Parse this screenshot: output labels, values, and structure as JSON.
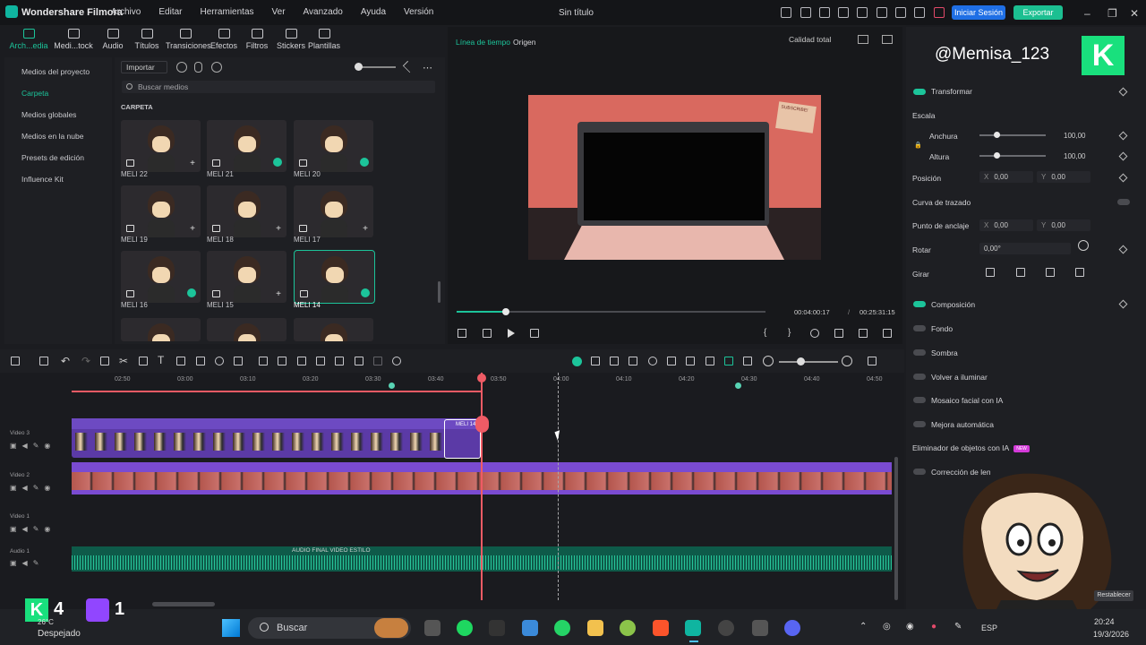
{
  "app": {
    "name": "Wondershare Filmora",
    "title": "Sin título"
  },
  "menu": [
    "Archivo",
    "Editar",
    "Herramientas",
    "Ver",
    "Avanzado",
    "Ayuda",
    "Versión"
  ],
  "header": {
    "login": "Iniciar Sesión",
    "export": "Exportar"
  },
  "tools": [
    {
      "label": "Arch...edia"
    },
    {
      "label": "Medi...tock"
    },
    {
      "label": "Audio"
    },
    {
      "label": "Títulos"
    },
    {
      "label": "Transiciones"
    },
    {
      "label": "Efectos"
    },
    {
      "label": "Filtros"
    },
    {
      "label": "Stickers"
    },
    {
      "label": "Plantillas"
    }
  ],
  "leftnav": [
    "Medios del proyecto",
    "Carpeta",
    "Medios globales",
    "Medios en la nube",
    "Presets de edición",
    "Influence Kit"
  ],
  "media": {
    "import": "Importar",
    "search_placeholder": "Buscar medios",
    "folder": "CARPETA",
    "items": [
      "MELI 22",
      "MELI 21",
      "MELI 20",
      "MELI 19",
      "MELI 18",
      "MELI 17",
      "MELI 16",
      "MELI 15",
      "MELI 14"
    ]
  },
  "preview": {
    "tab_timeline": "Línea de tiempo",
    "tab_source": "Origen",
    "quality": "Calidad total",
    "current_time": "00:04:00:17",
    "separator": "/",
    "total_time": "00:25:31:15",
    "progress": 0.16,
    "note": "SUBSCRIBE!"
  },
  "overlay": {
    "handle": "@Memisa_123",
    "logo_letter": "K",
    "kick_count": "4",
    "twitch_count": "1"
  },
  "props": {
    "transform": "Transformar",
    "scale": "Escala",
    "width": "Anchura",
    "width_val": "100,00",
    "height": "Altura",
    "height_val": "100,00",
    "position": "Posición",
    "x_label": "X",
    "y_label": "Y",
    "pos_x": "0,00",
    "pos_y": "0,00",
    "path_curve": "Curva de trazado",
    "anchor": "Punto de anclaje",
    "anchor_x": "0,00",
    "anchor_y": "0,00",
    "rotate": "Rotar",
    "rotate_val": "0,00°",
    "flip": "Girar",
    "composition": "Composición",
    "background": "Fondo",
    "shadow": "Sombra",
    "relight": "Volver a iluminar",
    "face_mosaic": "Mosaico facial con IA",
    "auto_enhance": "Mejora automática",
    "object_remover": "Eliminador de objetos con IA",
    "new_badge": "NEW",
    "correction": "Corrección de lente",
    "reset": "Restablecer"
  },
  "timeline": {
    "ruler": [
      "02:50",
      "03:00",
      "03:10",
      "03:20",
      "03:30",
      "03:40",
      "03:50",
      "04:00",
      "04:10",
      "04:20",
      "04:30",
      "04:40",
      "04:50"
    ],
    "tracks": [
      "Video 3",
      "Video 2",
      "Video 1",
      "Audio 1"
    ],
    "clip_v3": "MELI 14",
    "audio_clip": "AUDIO FINAL VIDEO ESTILO"
  },
  "taskbar": {
    "weather_temp": "26°C",
    "weather_text": "Despejado",
    "search": "Buscar",
    "lang": "ESP",
    "time": "20:24",
    "date": "19/3/2026"
  },
  "colors": {
    "accent": "#1cc49a",
    "playhead": "#ef5b65",
    "clip_video": "#6d4ac2",
    "clip_audio": "#0e5a49"
  }
}
